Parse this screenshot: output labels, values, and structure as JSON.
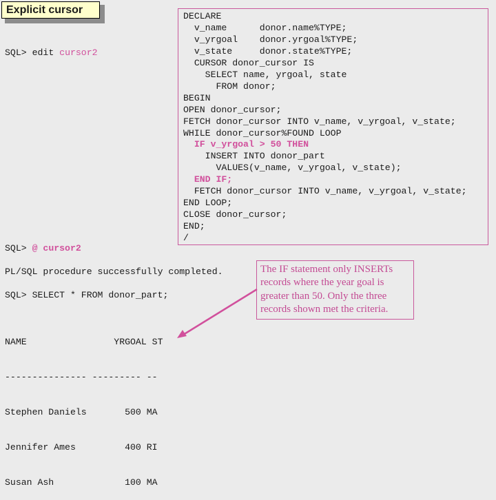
{
  "slide_title": "Explicit cursor",
  "terminal": {
    "edit_prompt": "SQL> ",
    "edit_cmd": "edit ",
    "edit_file": "cursor2",
    "run_prompt": "SQL> ",
    "run_at": "@ ",
    "run_file": "cursor2",
    "status": "PL/SQL procedure successfully completed.",
    "select_cmd": "SQL> SELECT * FROM donor_part;"
  },
  "code_lines": [
    {
      "text": "DECLARE",
      "highlight": false
    },
    {
      "text": "  v_name      donor.name%TYPE;",
      "highlight": false
    },
    {
      "text": "  v_yrgoal    donor.yrgoal%TYPE;",
      "highlight": false
    },
    {
      "text": "  v_state     donor.state%TYPE;",
      "highlight": false
    },
    {
      "text": "  CURSOR donor_cursor IS",
      "highlight": false
    },
    {
      "text": "    SELECT name, yrgoal, state",
      "highlight": false
    },
    {
      "text": "      FROM donor;",
      "highlight": false
    },
    {
      "text": "BEGIN",
      "highlight": false
    },
    {
      "text": "OPEN donor_cursor;",
      "highlight": false
    },
    {
      "text": "FETCH donor_cursor INTO v_name, v_yrgoal, v_state;",
      "highlight": false
    },
    {
      "text": "WHILE donor_cursor%FOUND LOOP",
      "highlight": false
    },
    {
      "text": "  IF v_yrgoal > 50 THEN",
      "highlight": true
    },
    {
      "text": "    INSERT INTO donor_part",
      "highlight": false
    },
    {
      "text": "      VALUES(v_name, v_yrgoal, v_state);",
      "highlight": false
    },
    {
      "text": "  END IF;",
      "highlight": true
    },
    {
      "text": "  FETCH donor_cursor INTO v_name, v_yrgoal, v_state;",
      "highlight": false
    },
    {
      "text": "END LOOP;",
      "highlight": false
    },
    {
      "text": "CLOSE donor_cursor;",
      "highlight": false
    },
    {
      "text": "END;",
      "highlight": false
    },
    {
      "text": "/",
      "highlight": false
    }
  ],
  "result_table": {
    "header": "NAME                YRGOAL ST",
    "separator": "--------------- --------- --",
    "columns": [
      "NAME",
      "YRGOAL",
      "ST"
    ],
    "rows": [
      {
        "name": "Stephen Daniels",
        "yrgoal": "500",
        "st": "MA",
        "line": "Stephen Daniels       500 MA"
      },
      {
        "name": "Jennifer Ames",
        "yrgoal": "400",
        "st": "RI",
        "line": "Jennifer Ames         400 RI"
      },
      {
        "name": "Susan Ash",
        "yrgoal": "100",
        "st": "MA",
        "line": "Susan Ash             100 MA"
      }
    ]
  },
  "callout_text": "The IF statement only INSERTs records where the year goal is greater than 50.  Only the three records shown met the criteria.",
  "colors": {
    "accent": "#c9589c",
    "title_bg": "#ffffcc",
    "background": "#ebebeb"
  }
}
